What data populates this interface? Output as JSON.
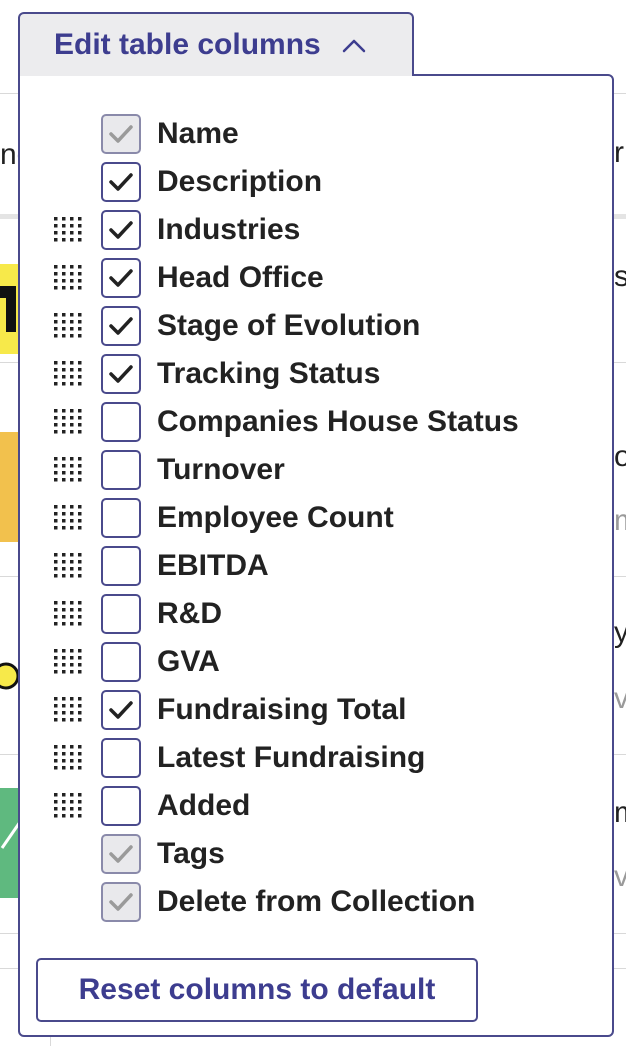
{
  "toggle": {
    "label": "Edit table columns",
    "icon": "chevron-up-icon"
  },
  "columns": [
    {
      "label": "Name",
      "checked": true,
      "locked": true,
      "draggable": false
    },
    {
      "label": "Description",
      "checked": true,
      "locked": false,
      "draggable": false
    },
    {
      "label": "Industries",
      "checked": true,
      "locked": false,
      "draggable": true
    },
    {
      "label": "Head Office",
      "checked": true,
      "locked": false,
      "draggable": true
    },
    {
      "label": "Stage of Evolution",
      "checked": true,
      "locked": false,
      "draggable": true
    },
    {
      "label": "Tracking Status",
      "checked": true,
      "locked": false,
      "draggable": true
    },
    {
      "label": "Companies House Status",
      "checked": false,
      "locked": false,
      "draggable": true
    },
    {
      "label": "Turnover",
      "checked": false,
      "locked": false,
      "draggable": true
    },
    {
      "label": "Employee Count",
      "checked": false,
      "locked": false,
      "draggable": true
    },
    {
      "label": "EBITDA",
      "checked": false,
      "locked": false,
      "draggable": true
    },
    {
      "label": "R&D",
      "checked": false,
      "locked": false,
      "draggable": true
    },
    {
      "label": "GVA",
      "checked": false,
      "locked": false,
      "draggable": true
    },
    {
      "label": "Fundraising Total",
      "checked": true,
      "locked": false,
      "draggable": true
    },
    {
      "label": "Latest Fundraising",
      "checked": false,
      "locked": false,
      "draggable": true
    },
    {
      "label": "Added",
      "checked": false,
      "locked": false,
      "draggable": true
    },
    {
      "label": "Tags",
      "checked": true,
      "locked": true,
      "draggable": false
    },
    {
      "label": "Delete from Collection",
      "checked": true,
      "locked": true,
      "draggable": false
    }
  ],
  "reset": {
    "label": "Reset columns to default"
  },
  "background": {
    "fragments": [
      {
        "text": "ne",
        "soft": false
      },
      {
        "text": "r",
        "soft": false
      },
      {
        "text": "s",
        "soft": false
      },
      {
        "text": "o",
        "soft": false
      },
      {
        "text": "m",
        "soft": true
      },
      {
        "text": "y",
        "soft": false
      },
      {
        "text": "ve",
        "soft": true
      },
      {
        "text": "m",
        "soft": false
      },
      {
        "text": "ve",
        "soft": true
      }
    ]
  },
  "colors": {
    "accent": "#3d3d8f",
    "border": "#4a4a8c",
    "check": "#222222",
    "check_locked": "#9a9a9a"
  }
}
